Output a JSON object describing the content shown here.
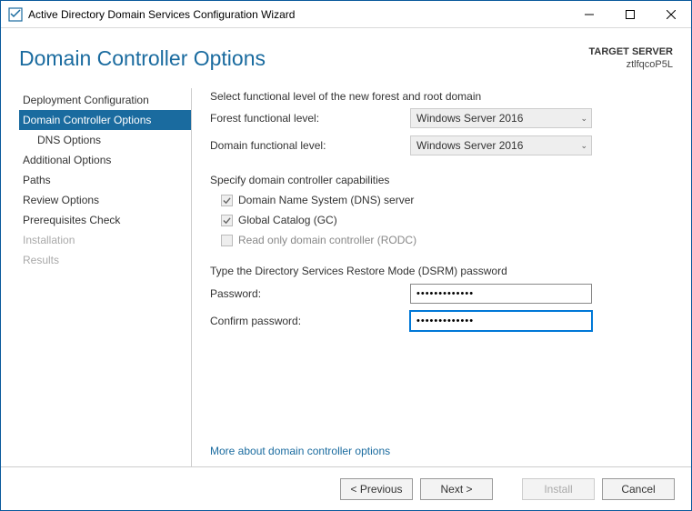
{
  "titlebar": {
    "title": "Active Directory Domain Services Configuration Wizard"
  },
  "header": {
    "heading": "Domain Controller Options",
    "target_label": "TARGET SERVER",
    "target_value": "ztlfqcoP5L"
  },
  "steps": [
    {
      "label": "Deployment Configuration",
      "sel": false,
      "sub": false,
      "dis": false
    },
    {
      "label": "Domain Controller Options",
      "sel": true,
      "sub": false,
      "dis": false
    },
    {
      "label": "DNS Options",
      "sel": false,
      "sub": true,
      "dis": false
    },
    {
      "label": "Additional Options",
      "sel": false,
      "sub": false,
      "dis": false
    },
    {
      "label": "Paths",
      "sel": false,
      "sub": false,
      "dis": false
    },
    {
      "label": "Review Options",
      "sel": false,
      "sub": false,
      "dis": false
    },
    {
      "label": "Prerequisites Check",
      "sel": false,
      "sub": false,
      "dis": false
    },
    {
      "label": "Installation",
      "sel": false,
      "sub": false,
      "dis": true
    },
    {
      "label": "Results",
      "sel": false,
      "sub": false,
      "dis": true
    }
  ],
  "main": {
    "section1": "Select functional level of the new forest and root domain",
    "forest_label": "Forest functional level:",
    "forest_value": "Windows Server 2016",
    "domain_label": "Domain functional level:",
    "domain_value": "Windows Server 2016",
    "section2": "Specify domain controller capabilities",
    "chk_dns": "Domain Name System (DNS) server",
    "chk_gc": "Global Catalog (GC)",
    "chk_rodc": "Read only domain controller (RODC)",
    "section3": "Type the Directory Services Restore Mode (DSRM) password",
    "pw_label": "Password:",
    "pw_value": "•••••••••••••",
    "pw2_label": "Confirm password:",
    "pw2_value": "•••••••••••••",
    "morelink": "More about domain controller options"
  },
  "footer": {
    "prev": "< Previous",
    "next": "Next >",
    "install": "Install",
    "cancel": "Cancel"
  }
}
